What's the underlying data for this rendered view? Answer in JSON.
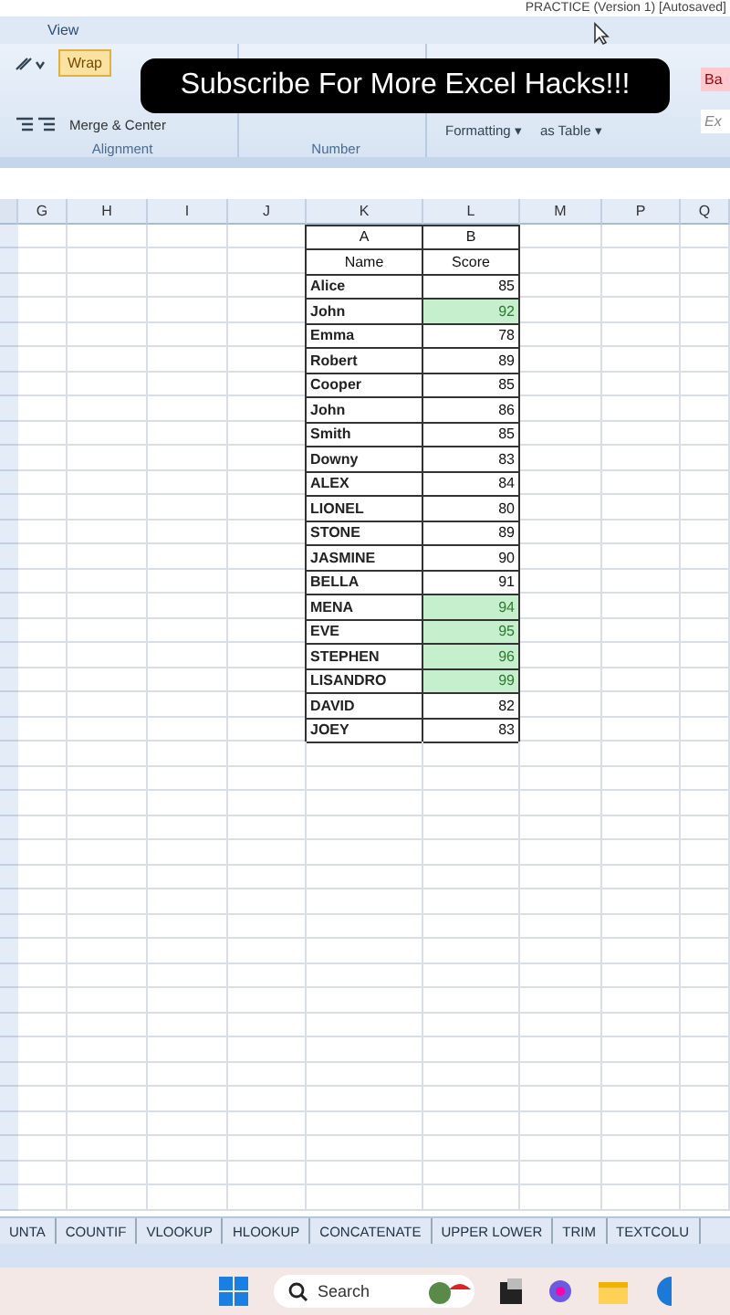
{
  "window": {
    "title": "PRACTICE (Version 1) [Autosaved]"
  },
  "ribbon": {
    "tab": "View",
    "wrap_button": "Wrap",
    "merge_button": "Merge & Center",
    "groups": [
      "Alignment",
      "Number"
    ],
    "format_buttons": [
      "Formatting ▾",
      "as Table ▾"
    ],
    "styles": [
      {
        "label": "Ba",
        "kind": "bad"
      },
      {
        "label": "Ex",
        "kind": "explanatory"
      }
    ]
  },
  "overlay_caption": "Subscribe For More Excel Hacks!!!",
  "sheet": {
    "columns": [
      "G",
      "H",
      "I",
      "J",
      "K",
      "L",
      "M",
      "P",
      "Q"
    ],
    "table": {
      "letters": [
        "A",
        "B"
      ],
      "headers": [
        "Name",
        "Score"
      ],
      "rows": [
        {
          "name": "Alice",
          "score": "85",
          "highlighted": false
        },
        {
          "name": "John",
          "score": "92",
          "highlighted": true
        },
        {
          "name": "Emma",
          "score": "78",
          "highlighted": false
        },
        {
          "name": "Robert",
          "score": "89",
          "highlighted": false
        },
        {
          "name": "Cooper",
          "score": "85",
          "highlighted": false
        },
        {
          "name": "John",
          "score": "86",
          "highlighted": false
        },
        {
          "name": "Smith",
          "score": "85",
          "highlighted": false
        },
        {
          "name": "Downy",
          "score": "83",
          "highlighted": false
        },
        {
          "name": "ALEX",
          "score": "84",
          "highlighted": false
        },
        {
          "name": "LIONEL",
          "score": "80",
          "highlighted": false
        },
        {
          "name": "STONE",
          "score": "89",
          "highlighted": false
        },
        {
          "name": "JASMINE",
          "score": "90",
          "highlighted": false
        },
        {
          "name": "BELLA",
          "score": "91",
          "highlighted": false
        },
        {
          "name": "MENA",
          "score": "94",
          "highlighted": true
        },
        {
          "name": "EVE",
          "score": "95",
          "highlighted": true
        },
        {
          "name": "STEPHEN",
          "score": "96",
          "highlighted": true
        },
        {
          "name": "LISANDRO",
          "score": "99",
          "highlighted": true
        },
        {
          "name": "DAVID",
          "score": "82",
          "highlighted": false
        },
        {
          "name": "JOEY",
          "score": "83",
          "highlighted": false
        }
      ]
    }
  },
  "sheet_tabs": [
    "UNTA",
    "COUNTIF",
    "VLOOKUP",
    "HLOOKUP",
    "CONCATENATE",
    "UPPER LOWER",
    "TRIM",
    "TEXTCOLU"
  ],
  "taskbar": {
    "search": {
      "placeholder": "Search"
    }
  }
}
